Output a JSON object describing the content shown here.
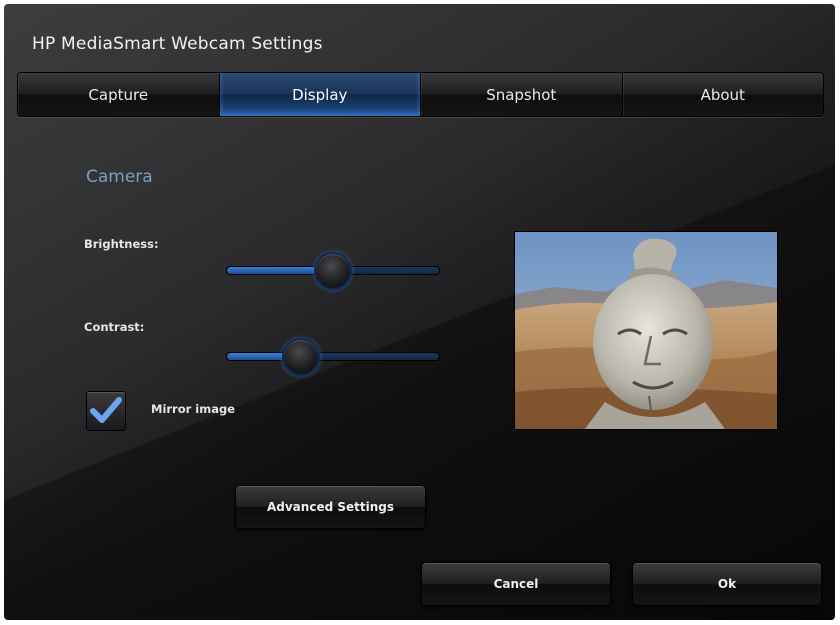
{
  "window": {
    "title": "HP MediaSmart Webcam Settings"
  },
  "tabs": [
    {
      "label": "Capture",
      "active": false
    },
    {
      "label": "Display",
      "active": true
    },
    {
      "label": "Snapshot",
      "active": false
    },
    {
      "label": "About",
      "active": false
    }
  ],
  "camera": {
    "section_title": "Camera",
    "brightness": {
      "label": "Brightness:",
      "value": 0.49
    },
    "contrast": {
      "label": "Contrast:",
      "value": 0.34
    },
    "mirror_image": {
      "label": "Mirror image",
      "checked": true
    }
  },
  "preview": {
    "icon": "webcam-preview-image"
  },
  "buttons": {
    "advanced_settings": "Advanced Settings",
    "cancel": "Cancel",
    "ok": "Ok"
  },
  "colors": {
    "accent": "#1e4f8c",
    "section_title": "#7f9fc6",
    "check": "#6aa6ef"
  }
}
